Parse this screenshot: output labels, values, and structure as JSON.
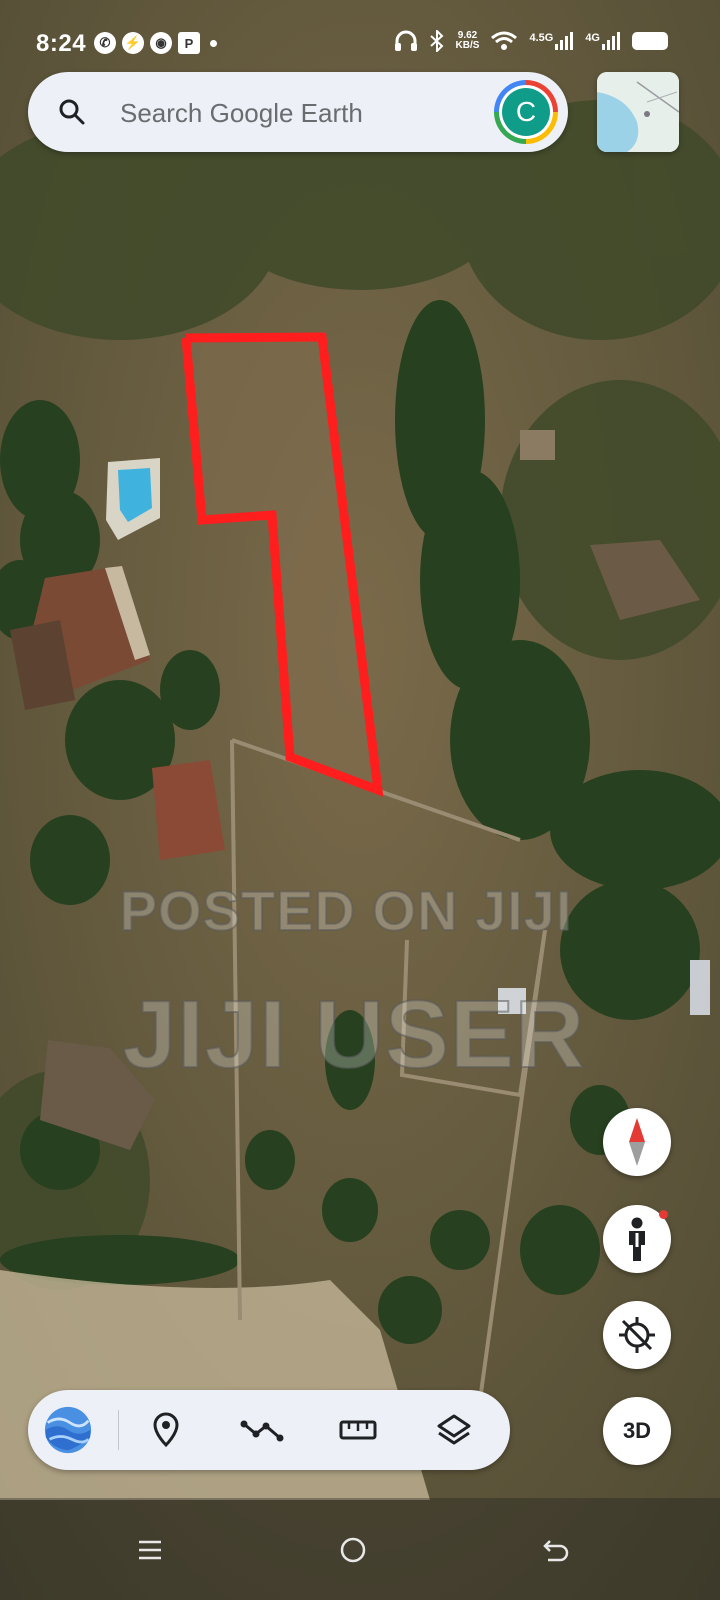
{
  "status_bar": {
    "time": "8:24",
    "net_speed_value": "9.62",
    "net_speed_unit": "KB/S",
    "signal_1_label": "4.5G",
    "signal_2_label": "4G",
    "icons": [
      "whatsapp-icon",
      "messenger-icon",
      "chrome-icon",
      "pdf-icon",
      "headphones-icon",
      "bluetooth-icon",
      "wifi-icon",
      "battery-icon"
    ]
  },
  "search": {
    "placeholder": "Search Google Earth",
    "avatar_letter": "C"
  },
  "watermark": {
    "line1": "POSTED ON JIJI",
    "line2": "JIJI USER"
  },
  "map_controls": {
    "three_d_label": "3D"
  },
  "toolbar": {
    "items": [
      "voyager-icon",
      "place-marker-icon",
      "path-icon",
      "measure-icon",
      "layers-icon"
    ]
  },
  "colors": {
    "boundary": "#ff1e1e",
    "ui_surface": "#edf1f7",
    "avatar_bg": "#0f9d8a"
  }
}
